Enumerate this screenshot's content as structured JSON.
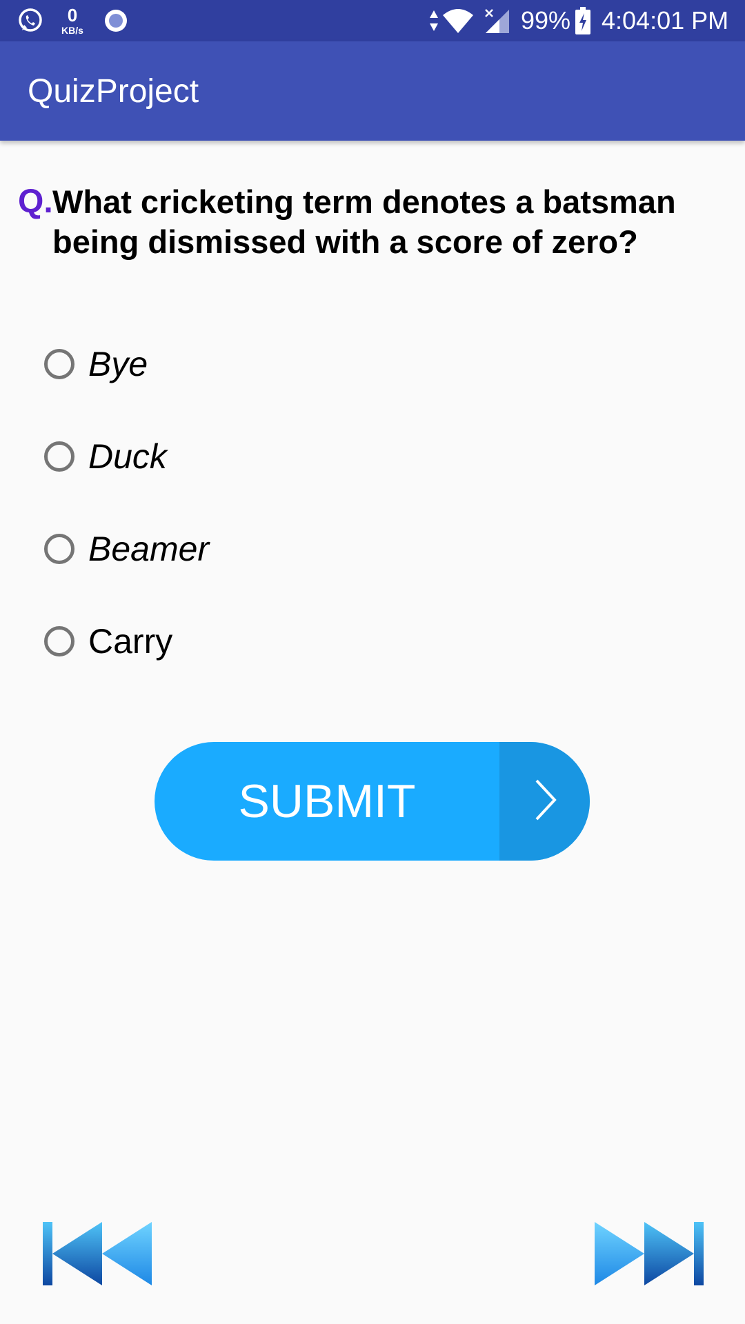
{
  "status_bar": {
    "net_speed_value": "0",
    "net_speed_unit": "KB/s",
    "battery_percent": "99%",
    "time": "4:04:01 PM",
    "icons": [
      "whatsapp-icon",
      "record-icon",
      "data-arrows-icon",
      "wifi-icon",
      "signal-icon",
      "battery-charging-icon"
    ]
  },
  "app_bar": {
    "title": "QuizProject",
    "color": "#3f51b5"
  },
  "question": {
    "prefix": "Q.",
    "text": "What cricketing term denotes a batsman being dismissed with a score of zero?",
    "prefix_color": "#5e20d0"
  },
  "options": [
    {
      "label": "Bye",
      "selected": false
    },
    {
      "label": "Duck",
      "selected": false
    },
    {
      "label": "Beamer",
      "selected": false
    },
    {
      "label": "Carry",
      "selected": false
    }
  ],
  "submit": {
    "label": "SUBMIT",
    "color": "#1aabff",
    "icon": "chevron-right-icon"
  },
  "navigation": {
    "prev_icon": "skip-previous-icon",
    "next_icon": "skip-next-icon"
  }
}
